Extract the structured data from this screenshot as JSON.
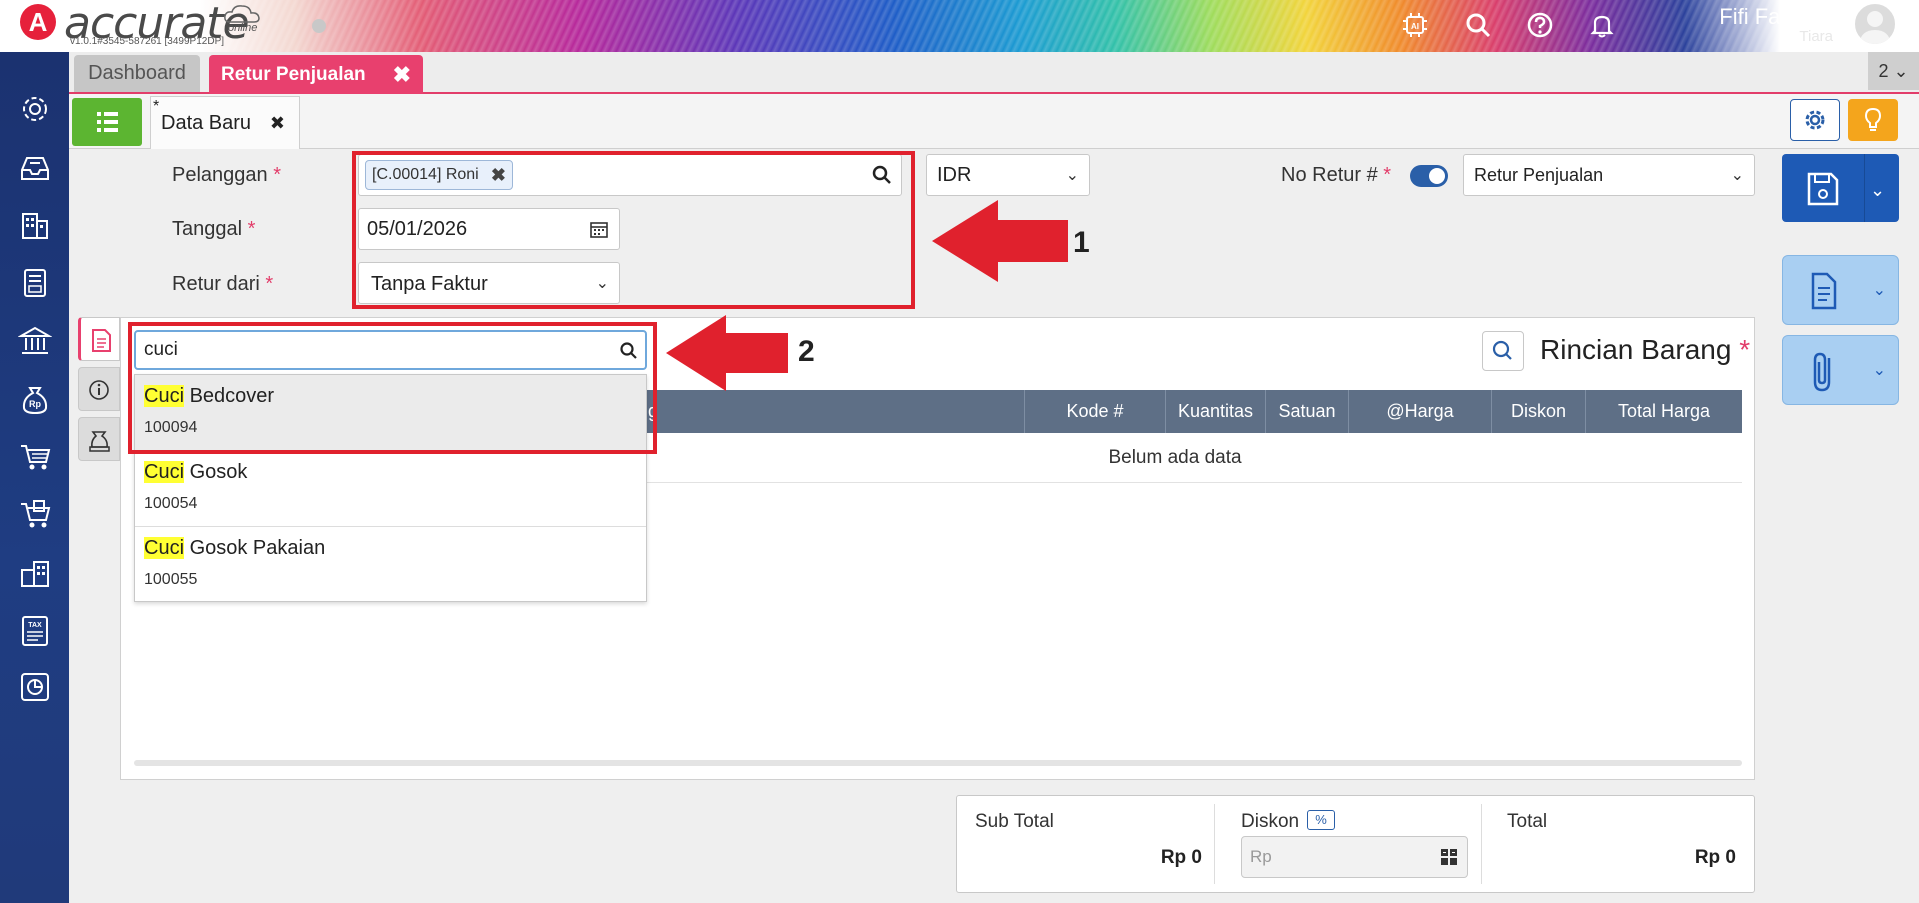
{
  "brand": {
    "logo_letter": "A",
    "name": "accurate",
    "sub": "online",
    "version": "v1.0.1#3545-587261 [3499P12DP]"
  },
  "header": {
    "ai_label": "AI",
    "user_name": "Fifi Fashion",
    "user_sub": "Tiara"
  },
  "tabs": [
    {
      "label": "Dashboard"
    },
    {
      "label": "Retur Penjualan",
      "close": "✖"
    }
  ],
  "tab_count": "2",
  "subtab": {
    "star": "*",
    "label": "Data Baru",
    "close": "✖"
  },
  "form": {
    "pelanggan_label": "Pelanggan",
    "req": "*",
    "pelanggan_chip": "[C.00014] Roni",
    "chip_close": "✖",
    "currency": "IDR",
    "no_retur_label": "No Retur #",
    "retur_type": "Retur Penjualan",
    "tanggal_label": "Tanggal",
    "tanggal_value": "05/01/2026",
    "retur_dari_label": "Retur dari",
    "retur_dari_value": "Tanpa Faktur"
  },
  "annotations": {
    "one": "1",
    "two": "2"
  },
  "items_panel": {
    "title": "Rincian Barang",
    "req": "*",
    "columns": [
      "Kode #",
      "Kuantitas",
      "Satuan",
      "@Harga",
      "Diskon",
      "Total Harga"
    ],
    "partial_col": "g",
    "empty": "Belum ada data"
  },
  "search": {
    "query": "cuci",
    "results": [
      {
        "hl": "Cuci",
        "rest": " Bedcover",
        "code": "100094"
      },
      {
        "hl": "Cuci",
        "rest": " Gosok",
        "code": "100054"
      },
      {
        "hl": "Cuci",
        "rest": " Gosok Pakaian",
        "code": "100055"
      }
    ]
  },
  "totals": {
    "sub_total_label": "Sub Total",
    "sub_total_value": "Rp 0",
    "diskon_label": "Diskon",
    "diskon_pct": "%",
    "diskon_placeholder": "Rp",
    "total_label": "Total",
    "total_value": "Rp 0"
  },
  "colors": {
    "accent_pink": "#e8406e",
    "primary_blue": "#1e5ab5",
    "sidebar": "#1f3d82",
    "green": "#5cb531",
    "annotation_red": "#e0212d"
  }
}
